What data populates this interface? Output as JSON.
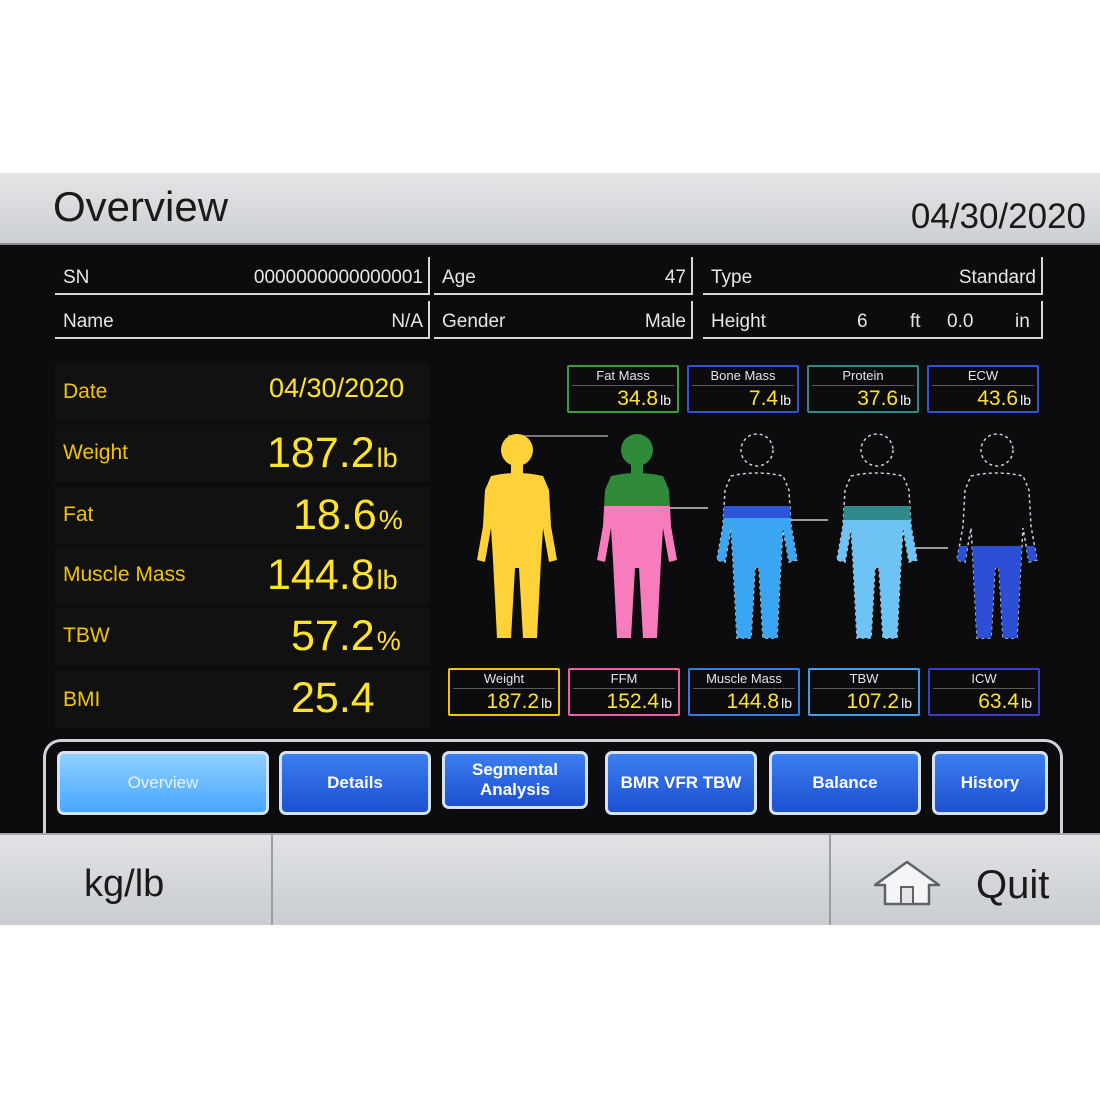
{
  "header": {
    "title": "Overview",
    "date": "04/30/2020"
  },
  "info": {
    "sn_label": "SN",
    "sn_value": "0000000000000001",
    "age_label": "Age",
    "age_value": "47",
    "type_label": "Type",
    "type_value": "Standard",
    "name_label": "Name",
    "name_value": "N/A",
    "gender_label": "Gender",
    "gender_value": "Male",
    "height_label": "Height",
    "height_ft": "6",
    "height_ft_unit": "ft",
    "height_in": "0.0",
    "height_in_unit": "in"
  },
  "stats": {
    "date_label": "Date",
    "date_value": "04/30/2020",
    "weight_label": "Weight",
    "weight_value": "187.2",
    "weight_unit": "lb",
    "fat_label": "Fat",
    "fat_value": "18.6",
    "fat_unit": "%",
    "muscle_label": "Muscle Mass",
    "muscle_value": "144.8",
    "muscle_unit": "lb",
    "tbw_label": "TBW",
    "tbw_value": "57.2",
    "tbw_unit": "%",
    "bmi_label": "BMI",
    "bmi_value": "25.4"
  },
  "top_boxes": [
    {
      "label": "Fat Mass",
      "value": "34.8",
      "unit": "lb",
      "color": "#3d9b3d"
    },
    {
      "label": "Bone Mass",
      "value": "7.4",
      "unit": "lb",
      "color": "#2f53d6"
    },
    {
      "label": "Protein",
      "value": "37.6",
      "unit": "lb",
      "color": "#2f8a86"
    },
    {
      "label": "ECW",
      "value": "43.6",
      "unit": "lb",
      "color": "#2f53d6"
    }
  ],
  "bottom_boxes": [
    {
      "label": "Weight",
      "value": "187.2",
      "unit": "lb",
      "color": "#f0c400"
    },
    {
      "label": "FFM",
      "value": "152.4",
      "unit": "lb",
      "color": "#ee5fa8"
    },
    {
      "label": "Muscle Mass",
      "value": "144.8",
      "unit": "lb",
      "color": "#2f7fe0"
    },
    {
      "label": "TBW",
      "value": "107.2",
      "unit": "lb",
      "color": "#3d9fe8"
    },
    {
      "label": "ICW",
      "value": "63.4",
      "unit": "lb",
      "color": "#3a3fc8"
    }
  ],
  "tabs": [
    {
      "label": "Overview"
    },
    {
      "label": "Details"
    },
    {
      "label": "Segmental Analysis"
    },
    {
      "label": "BMR VFR TBW"
    },
    {
      "label": "Balance"
    },
    {
      "label": "History"
    }
  ],
  "bottom_bar": {
    "units_label": "kg/lb",
    "quit_label": "Quit",
    "quit_icon": "home-icon"
  },
  "colors": {
    "yellow": "#ffe32a",
    "fat_green": "#3d8a3a",
    "ffm_pink": "#f27bb6",
    "muscle_blue": "#3aa8f2",
    "tbw_teal": "#3a8b8c",
    "icw_indigo": "#2e4fd0"
  }
}
